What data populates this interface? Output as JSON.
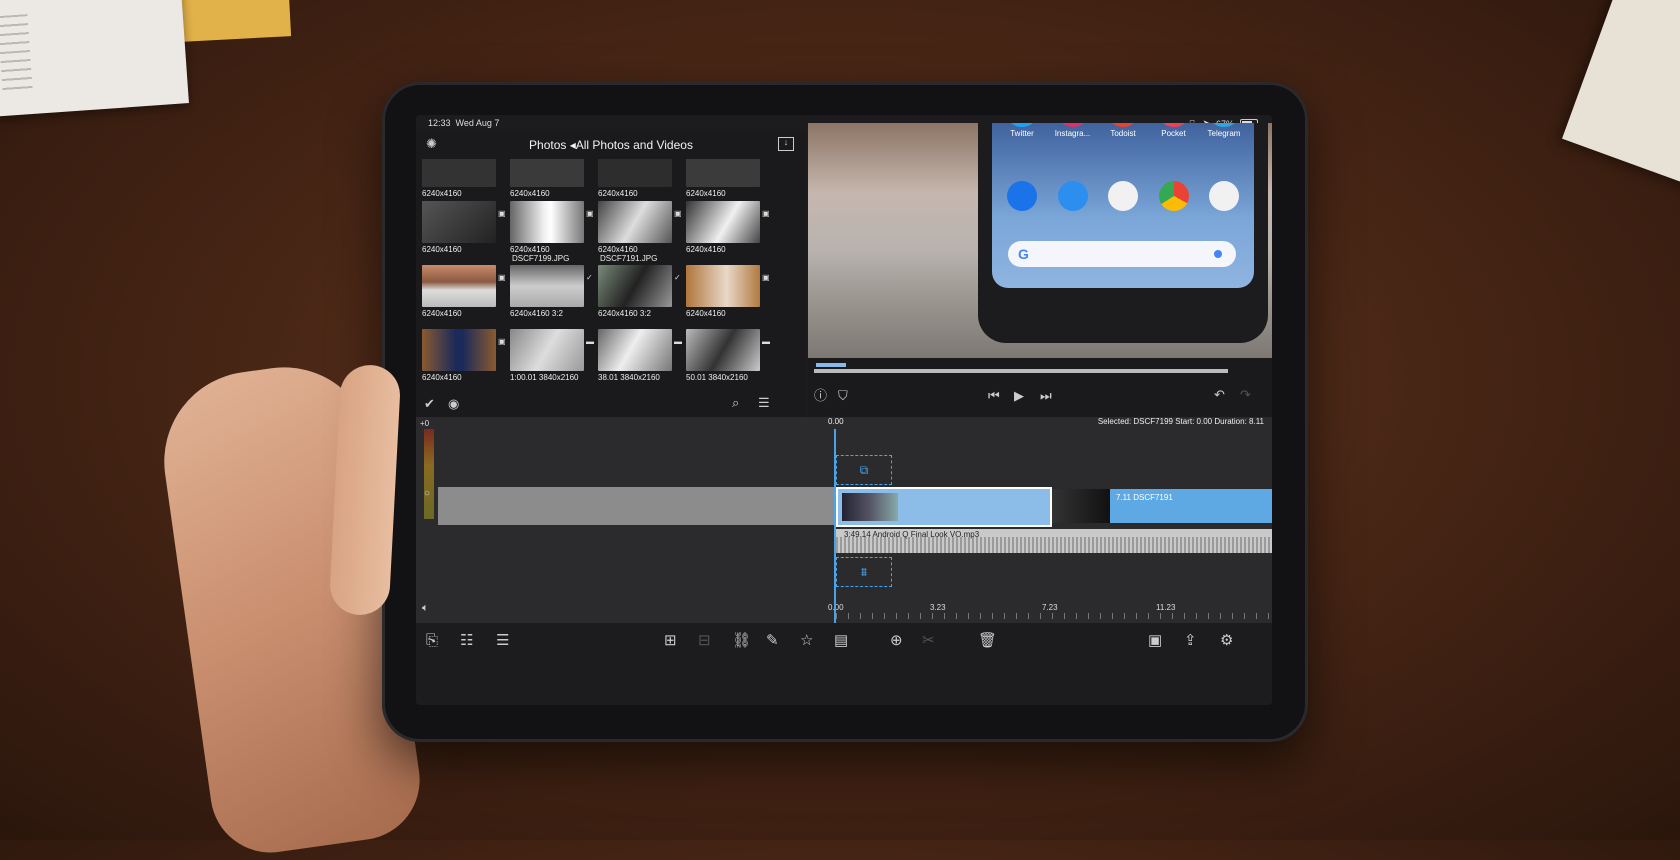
{
  "status": {
    "time": "12:33",
    "date": "Wed Aug 7",
    "battery": "67%"
  },
  "library": {
    "title": "Photos ◂All Photos and Videos",
    "rows": [
      [
        {
          "cap": "6240x4160"
        },
        {
          "cap": "6240x4160"
        },
        {
          "cap": "6240x4160"
        },
        {
          "cap": "6240x4160"
        }
      ],
      [
        {
          "cap": "6240x4160"
        },
        {
          "cap": "6240x4160"
        },
        {
          "cap": "6240x4160"
        },
        {
          "cap": "6240x4160"
        }
      ],
      [
        {
          "cap": "6240x4160"
        },
        {
          "cap": "6240x4160  3:2",
          "name": "DSCF7199.JPG"
        },
        {
          "cap": "6240x4160  3:2",
          "name": "DSCF7191.JPG"
        },
        {
          "cap": "6240x4160"
        }
      ],
      [
        {
          "cap": "6240x4160"
        },
        {
          "cap": "1:00.01  3840x2160"
        },
        {
          "cap": "38.01  3840x2160"
        },
        {
          "cap": "50.01  3840x2160"
        }
      ]
    ]
  },
  "preview": {
    "apps_top": [
      "Twitter",
      "Instagra...",
      "Todoist",
      "Pocket",
      "Telegram"
    ]
  },
  "timeline": {
    "playhead_time": "0.00",
    "selected_info": "Selected: DSCF7199 Start: 0.00 Duration: 8.11",
    "left_level": "+0",
    "clip2_label": "7.11  DSCF7191",
    "audio_label": "3:49.14   Android Q Final Look VO.mp3",
    "ruler": [
      "0.00",
      "3.23",
      "7.23",
      "11.23"
    ]
  },
  "colors": {
    "accent": "#4aa3e8",
    "clip_selected": "#8bbde8",
    "clip": "#5ea9e4"
  }
}
